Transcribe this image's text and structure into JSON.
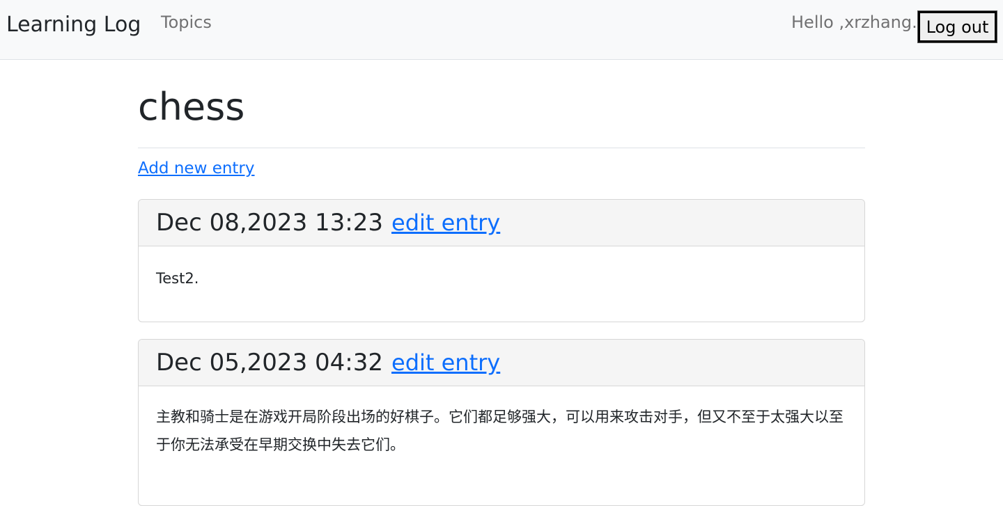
{
  "navbar": {
    "brand": "Learning Log",
    "topics": "Topics",
    "greeting": "Hello ,xrzhang.",
    "logout": "Log out"
  },
  "topic": {
    "title": "chess",
    "add_entry": "Add new entry"
  },
  "entries": [
    {
      "date": "Dec 08,2023 13:23",
      "edit": "edit entry",
      "text": "Test2."
    },
    {
      "date": "Dec 05,2023 04:32",
      "edit": "edit entry",
      "text": "主教和骑士是在游戏开局阶段出场的好棋子。它们都足够强大，可以用来攻击对手，但又不至于太强大以至于你无法承受在早期交换中失去它们。"
    }
  ]
}
